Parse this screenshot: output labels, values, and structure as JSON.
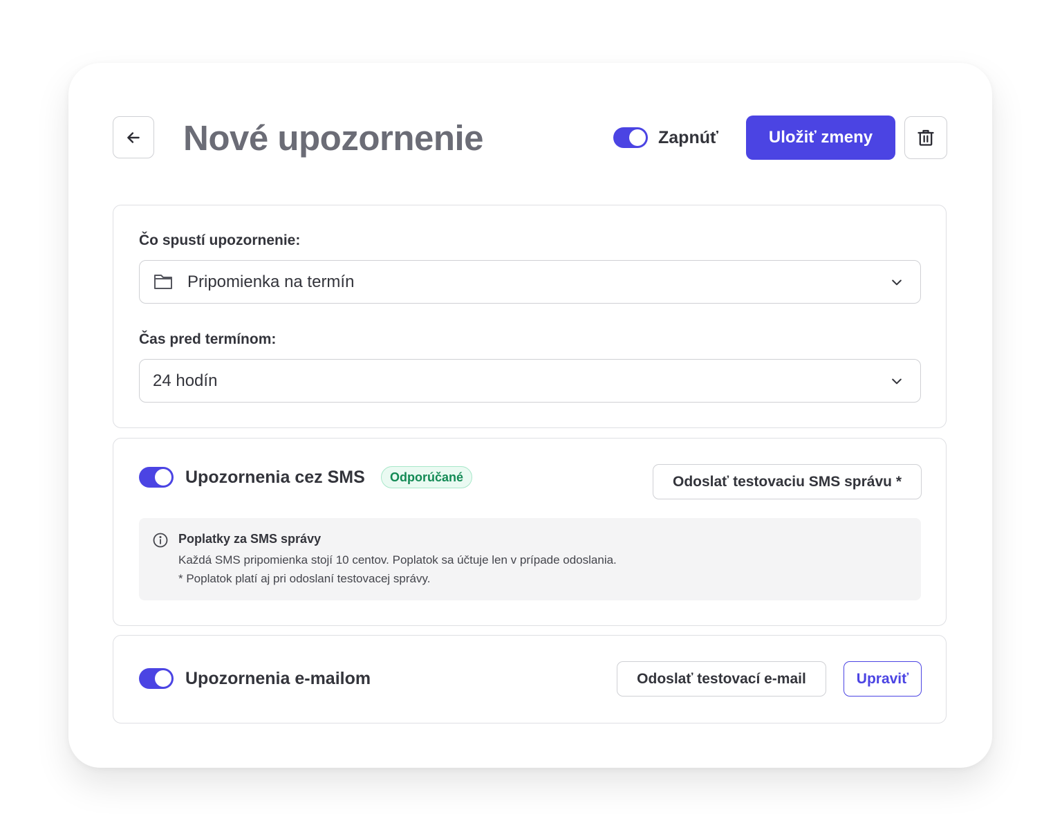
{
  "header": {
    "title": "Nové upozornenie",
    "enable_label": "Zapnúť",
    "enabled": true,
    "save_label": "Uložiť zmeny"
  },
  "trigger": {
    "label": "Čo spustí upozornenie:",
    "value": "Pripomienka na termín",
    "time_label": "Čas pred termínom:",
    "time_value": "24 hodín"
  },
  "sms": {
    "enabled": true,
    "title": "Upozornenia cez SMS",
    "badge": "Odporúčané",
    "test_button": "Odoslať testovaciu SMS správu *",
    "info_title": "Poplatky za SMS správy",
    "info_line1": "Každá SMS pripomienka stojí 10 centov. Poplatok sa účtuje len v prípade odoslania.",
    "info_line2": "* Poplatok platí aj pri odoslaní testovacej správy."
  },
  "email": {
    "enabled": true,
    "title": "Upozornenia e-mailom",
    "test_button": "Odoslať testovací e-mail",
    "edit_button": "Upraviť"
  },
  "colors": {
    "accent": "#4b44e3",
    "badge_green": "#138a55"
  }
}
